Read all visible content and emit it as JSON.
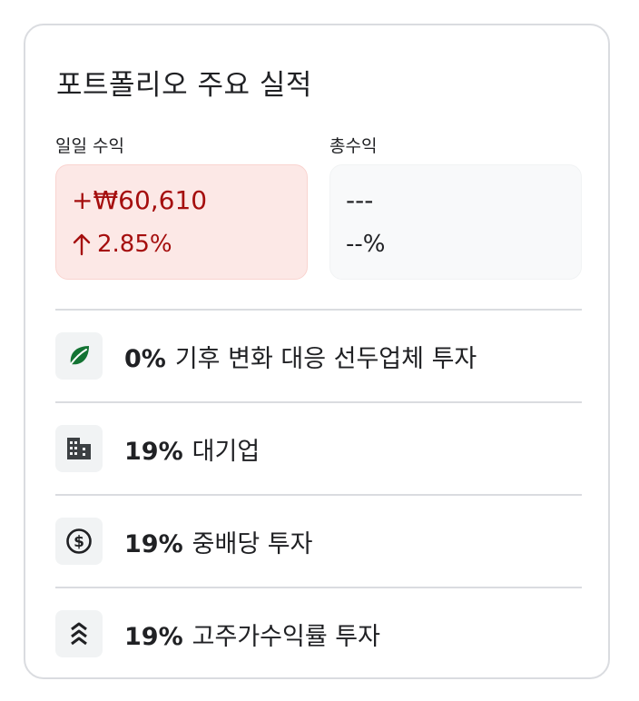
{
  "card": {
    "title": "포트폴리오 주요 실적"
  },
  "daily": {
    "label": "일일 수익",
    "amount": "+₩60,610",
    "change": "2.85%",
    "change_icon": "arrow-up-icon",
    "color": "#a50e0e"
  },
  "total": {
    "label": "총수익",
    "amount": "---",
    "change": "--%"
  },
  "breakdown": [
    {
      "percent": "0%",
      "label": "기후 변화 대응 선두업체 투자",
      "icon": "leaf-icon"
    },
    {
      "percent": "19%",
      "label": "대기업",
      "icon": "building-icon"
    },
    {
      "percent": "19%",
      "label": "중배당 투자",
      "icon": "dollar-coin-icon"
    },
    {
      "percent": "19%",
      "label": "고주가수익률 투자",
      "icon": "double-chevron-up-icon"
    }
  ]
}
